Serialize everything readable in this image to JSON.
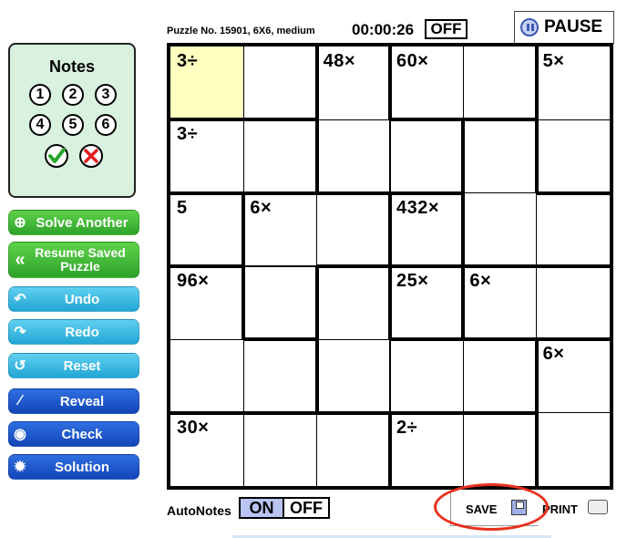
{
  "header": {
    "puzzle_info": "Puzzle No. 15901, 6X6, medium",
    "timer": "00:00:26",
    "timer_toggle": "OFF",
    "pause_label": "PAUSE"
  },
  "notes": {
    "title": "Notes",
    "numbers": [
      "1",
      "2",
      "3",
      "4",
      "5",
      "6"
    ],
    "confirm_icon": "check-icon",
    "cancel_icon": "x-icon"
  },
  "sidebar": {
    "buttons": [
      {
        "label": "Solve Another",
        "icon": "plus-circle-icon",
        "color": "green"
      },
      {
        "label": "Resume Saved Puzzle",
        "icon": "double-chevron-left-icon",
        "color": "green"
      },
      {
        "label": "Undo",
        "icon": "undo-icon",
        "color": "cyan"
      },
      {
        "label": "Redo",
        "icon": "redo-icon",
        "color": "cyan"
      },
      {
        "label": "Reset",
        "icon": "reset-icon",
        "color": "cyan"
      },
      {
        "label": "Reveal",
        "icon": "wand-icon",
        "color": "blue"
      },
      {
        "label": "Check",
        "icon": "eye-icon",
        "color": "blue"
      },
      {
        "label": "Solution",
        "icon": "lightbulb-icon",
        "color": "blue"
      }
    ]
  },
  "grid": {
    "size": 6,
    "selected_cell": [
      0,
      0
    ],
    "selected_color": "#ffffc0",
    "clues": [
      {
        "row": 0,
        "col": 0,
        "text": "3÷"
      },
      {
        "row": 0,
        "col": 2,
        "text": "48×"
      },
      {
        "row": 0,
        "col": 3,
        "text": "60×"
      },
      {
        "row": 0,
        "col": 5,
        "text": "5×"
      },
      {
        "row": 1,
        "col": 0,
        "text": "3÷"
      },
      {
        "row": 2,
        "col": 0,
        "text": "5"
      },
      {
        "row": 2,
        "col": 1,
        "text": "6×"
      },
      {
        "row": 2,
        "col": 3,
        "text": "432×"
      },
      {
        "row": 3,
        "col": 0,
        "text": "96×"
      },
      {
        "row": 3,
        "col": 3,
        "text": "25×"
      },
      {
        "row": 3,
        "col": 4,
        "text": "6×"
      },
      {
        "row": 4,
        "col": 5,
        "text": "6×"
      },
      {
        "row": 5,
        "col": 0,
        "text": "30×"
      },
      {
        "row": 5,
        "col": 3,
        "text": "2÷"
      }
    ],
    "cages": [
      [
        [
          0,
          0
        ],
        [
          0,
          1
        ]
      ],
      [
        [
          0,
          2
        ],
        [
          1,
          2
        ],
        [
          1,
          3
        ]
      ],
      [
        [
          0,
          3
        ],
        [
          0,
          4
        ]
      ],
      [
        [
          0,
          5
        ],
        [
          1,
          5
        ]
      ],
      [
        [
          1,
          0
        ],
        [
          1,
          1
        ]
      ],
      [
        [
          1,
          4
        ],
        [
          2,
          4
        ],
        [
          2,
          5
        ]
      ],
      [
        [
          2,
          0
        ]
      ],
      [
        [
          2,
          1
        ],
        [
          3,
          1
        ],
        [
          2,
          2
        ]
      ],
      [
        [
          2,
          3
        ],
        [
          3,
          2
        ],
        [
          4,
          2
        ],
        [
          4,
          3
        ],
        [
          4,
          4
        ]
      ],
      [
        [
          3,
          0
        ],
        [
          4,
          0
        ],
        [
          4,
          1
        ]
      ],
      [
        [
          3,
          3
        ],
        [
          5,
          3
        ]
      ],
      [
        [
          3,
          4
        ],
        [
          3,
          5
        ]
      ],
      [
        [
          4,
          5
        ],
        [
          5,
          5
        ]
      ],
      [
        [
          5,
          0
        ],
        [
          5,
          1
        ],
        [
          5,
          2
        ]
      ],
      [
        [
          5,
          3
        ],
        [
          5,
          4
        ]
      ]
    ]
  },
  "footer": {
    "autonotes_label": "AutoNotes",
    "autonotes_on": "ON",
    "autonotes_off": "OFF",
    "save_label": "SAVE",
    "print_label": "PRINT"
  },
  "colors": {
    "highlight_ring": "#e8311e",
    "notes_bg": "#d9f2df"
  }
}
